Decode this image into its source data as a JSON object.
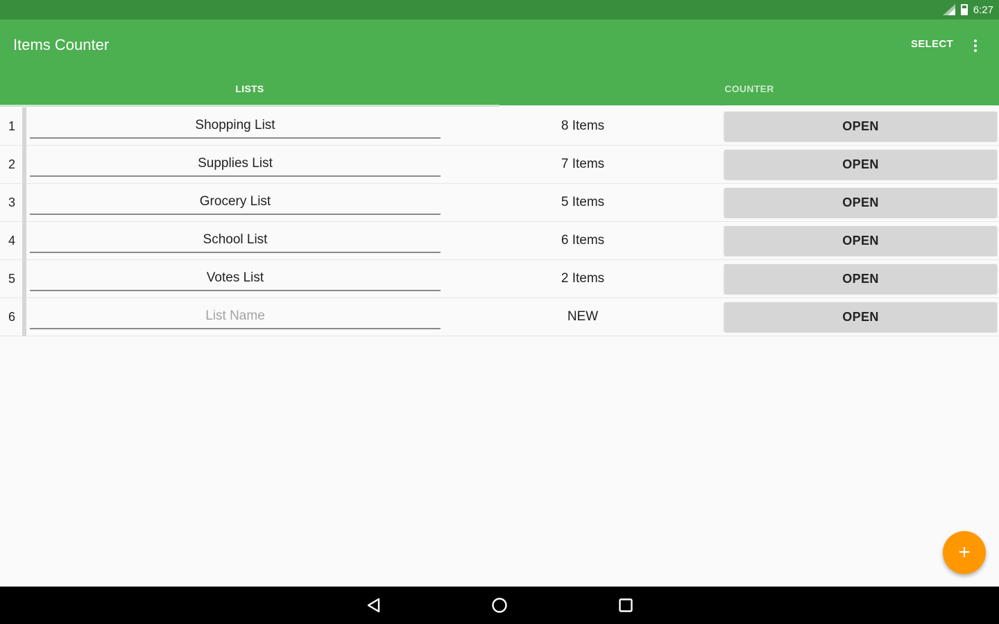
{
  "status_bar": {
    "time": "6:27",
    "icons": [
      "signal-icon",
      "battery-icon"
    ]
  },
  "app_bar": {
    "title": "Items Counter",
    "select_label": "SELECT",
    "overflow_icon": "more-vert-icon",
    "tabs": [
      {
        "label": "LISTS",
        "active": true
      },
      {
        "label": "COUNTER",
        "active": false
      }
    ]
  },
  "lists": {
    "rows": [
      {
        "index": "1",
        "name": "Shopping List",
        "placeholder": "",
        "count": "8 Items",
        "action": "OPEN"
      },
      {
        "index": "2",
        "name": "Supplies List",
        "placeholder": "",
        "count": "7 Items",
        "action": "OPEN"
      },
      {
        "index": "3",
        "name": "Grocery List",
        "placeholder": "",
        "count": "5 Items",
        "action": "OPEN"
      },
      {
        "index": "4",
        "name": "School List",
        "placeholder": "",
        "count": "6 Items",
        "action": "OPEN"
      },
      {
        "index": "5",
        "name": "Votes List",
        "placeholder": "",
        "count": "2 Items",
        "action": "OPEN"
      },
      {
        "index": "6",
        "name": "",
        "placeholder": "List Name",
        "count": "NEW",
        "action": "OPEN"
      }
    ]
  },
  "fab": {
    "symbol": "+",
    "icon": "add-icon"
  },
  "nav_bar": {
    "icons": [
      "back-icon",
      "home-icon",
      "recent-apps-icon"
    ]
  },
  "colors": {
    "status_bar": "#388e3c",
    "primary": "#4caf50",
    "tab_indicator": "#c8e6c9",
    "accent": "#ff9800",
    "button_bg": "#d6d6d6"
  }
}
